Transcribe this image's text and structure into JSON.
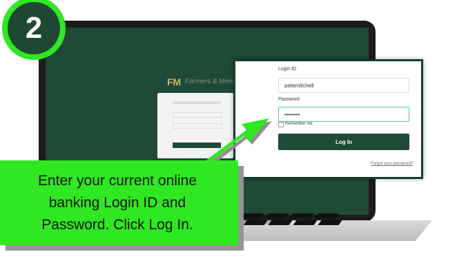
{
  "step": {
    "number": "2"
  },
  "login_card": {
    "login_id_label": "Login ID",
    "login_id_value": "petemitchell",
    "password_label": "Password",
    "password_value": "••••••••",
    "remember_label": "Remember me",
    "login_button": "Log In",
    "forgot_link": "Forgot your password?"
  },
  "background_brand": {
    "logo_text": "FM",
    "bank_name": "Farmers & Merch"
  },
  "callout": {
    "line1": "Enter your current online",
    "line2": "banking Login ID and",
    "line3": "Password. Click Log In."
  },
  "colors": {
    "brand_green": "#1f4a37",
    "highlight_green": "#2fe821",
    "accent_gold": "#c9b36f"
  }
}
